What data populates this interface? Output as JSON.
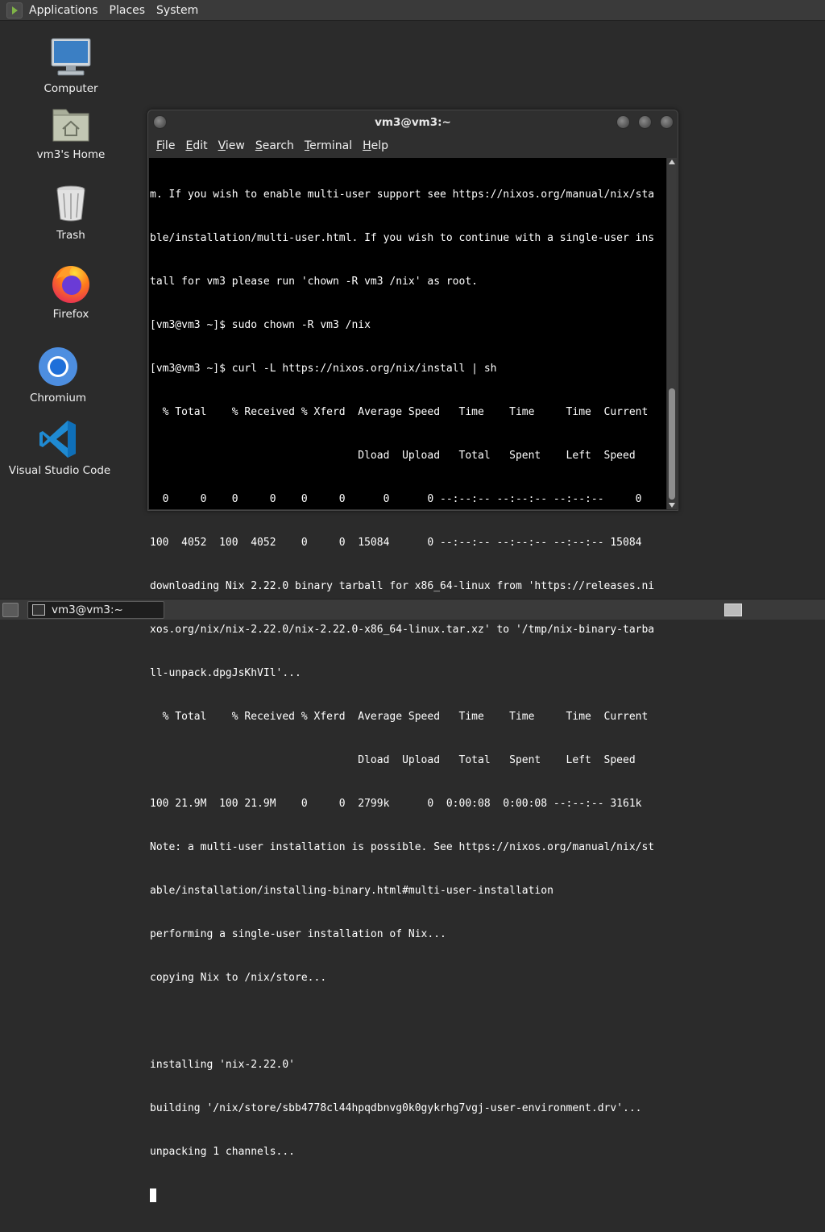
{
  "top_panel": {
    "menus": [
      "Applications",
      "Places",
      "System"
    ]
  },
  "desktop": {
    "icons": [
      {
        "label": "Computer",
        "icon": "computer-icon"
      },
      {
        "label": "vm3's Home",
        "icon": "home-folder-icon"
      },
      {
        "label": "Trash",
        "icon": "trash-icon"
      },
      {
        "label": "Firefox",
        "icon": "firefox-icon"
      },
      {
        "label": "Chromium",
        "icon": "chromium-icon"
      },
      {
        "label": "Visual Studio Code",
        "icon": "vscode-icon"
      }
    ]
  },
  "terminal": {
    "title": "vm3@vm3:~",
    "menus": [
      "File",
      "Edit",
      "View",
      "Search",
      "Terminal",
      "Help"
    ],
    "lines": [
      "m. If you wish to enable multi-user support see https://nixos.org/manual/nix/sta",
      "ble/installation/multi-user.html. If you wish to continue with a single-user ins",
      "tall for vm3 please run 'chown -R vm3 /nix' as root.",
      "[vm3@vm3 ~]$ sudo chown -R vm3 /nix",
      "[vm3@vm3 ~]$ curl -L https://nixos.org/nix/install | sh",
      "  % Total    % Received % Xferd  Average Speed   Time    Time     Time  Current",
      "                                 Dload  Upload   Total   Spent    Left  Speed",
      "  0     0    0     0    0     0      0      0 --:--:-- --:--:-- --:--:--     0",
      "100  4052  100  4052    0     0  15084      0 --:--:-- --:--:-- --:--:-- 15084",
      "downloading Nix 2.22.0 binary tarball for x86_64-linux from 'https://releases.ni",
      "xos.org/nix/nix-2.22.0/nix-2.22.0-x86_64-linux.tar.xz' to '/tmp/nix-binary-tarba",
      "ll-unpack.dpgJsKhVIl'...",
      "  % Total    % Received % Xferd  Average Speed   Time    Time     Time  Current",
      "                                 Dload  Upload   Total   Spent    Left  Speed",
      "100 21.9M  100 21.9M    0     0  2799k      0  0:00:08  0:00:08 --:--:-- 3161k",
      "Note: a multi-user installation is possible. See https://nixos.org/manual/nix/st",
      "able/installation/installing-binary.html#multi-user-installation",
      "performing a single-user installation of Nix...",
      "copying Nix to /nix/store...",
      "",
      "installing 'nix-2.22.0'",
      "building '/nix/store/sbb4778cl44hpqdbnvg0k0gykrhg7vgj-user-environment.drv'...",
      "unpacking 1 channels..."
    ]
  },
  "taskbar": {
    "window_button": "vm3@vm3:~"
  }
}
